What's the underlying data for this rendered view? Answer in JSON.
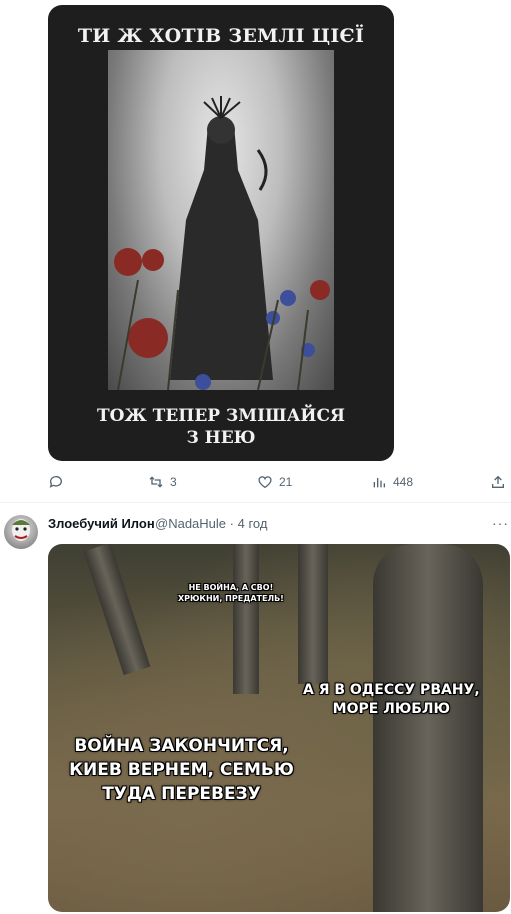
{
  "tweet1": {
    "image": {
      "caption_top": "ТИ Ж ХОТІВ ЗЕМЛІ ЦІЄЇ",
      "caption_bottom_line1": "ТОЖ ТЕПЕР ЗМІШАЙСЯ",
      "caption_bottom_line2": "З НЕЮ"
    },
    "actions": {
      "reply_count": "",
      "retweet_count": "3",
      "like_count": "21",
      "views_count": "448"
    }
  },
  "tweet2": {
    "author_name": "Злоебучий Илон",
    "author_handle": "@NadaHule",
    "time_separator": "·",
    "time": "4 год",
    "more_icon": "more-horizontal-icon",
    "image": {
      "text_top_line1": "НЕ ВОЙНА, А СВО!",
      "text_top_line2": "ХРЮКНИ, ПРЕДАТЕЛЬ!",
      "text_right_line1": "А Я В ОДЕССУ РВАНУ,",
      "text_right_line2": "МОРЕ ЛЮБЛЮ",
      "text_left_line1": "ВОЙНА ЗАКОНЧИТСЯ,",
      "text_left_line2": "КИЕВ ВЕРНЕМ, СЕМЬЮ",
      "text_left_line3": "ТУДА ПЕРЕВЕЗУ"
    }
  },
  "colors": {
    "secondary_text": "#536471",
    "divider": "#eff3f4"
  }
}
